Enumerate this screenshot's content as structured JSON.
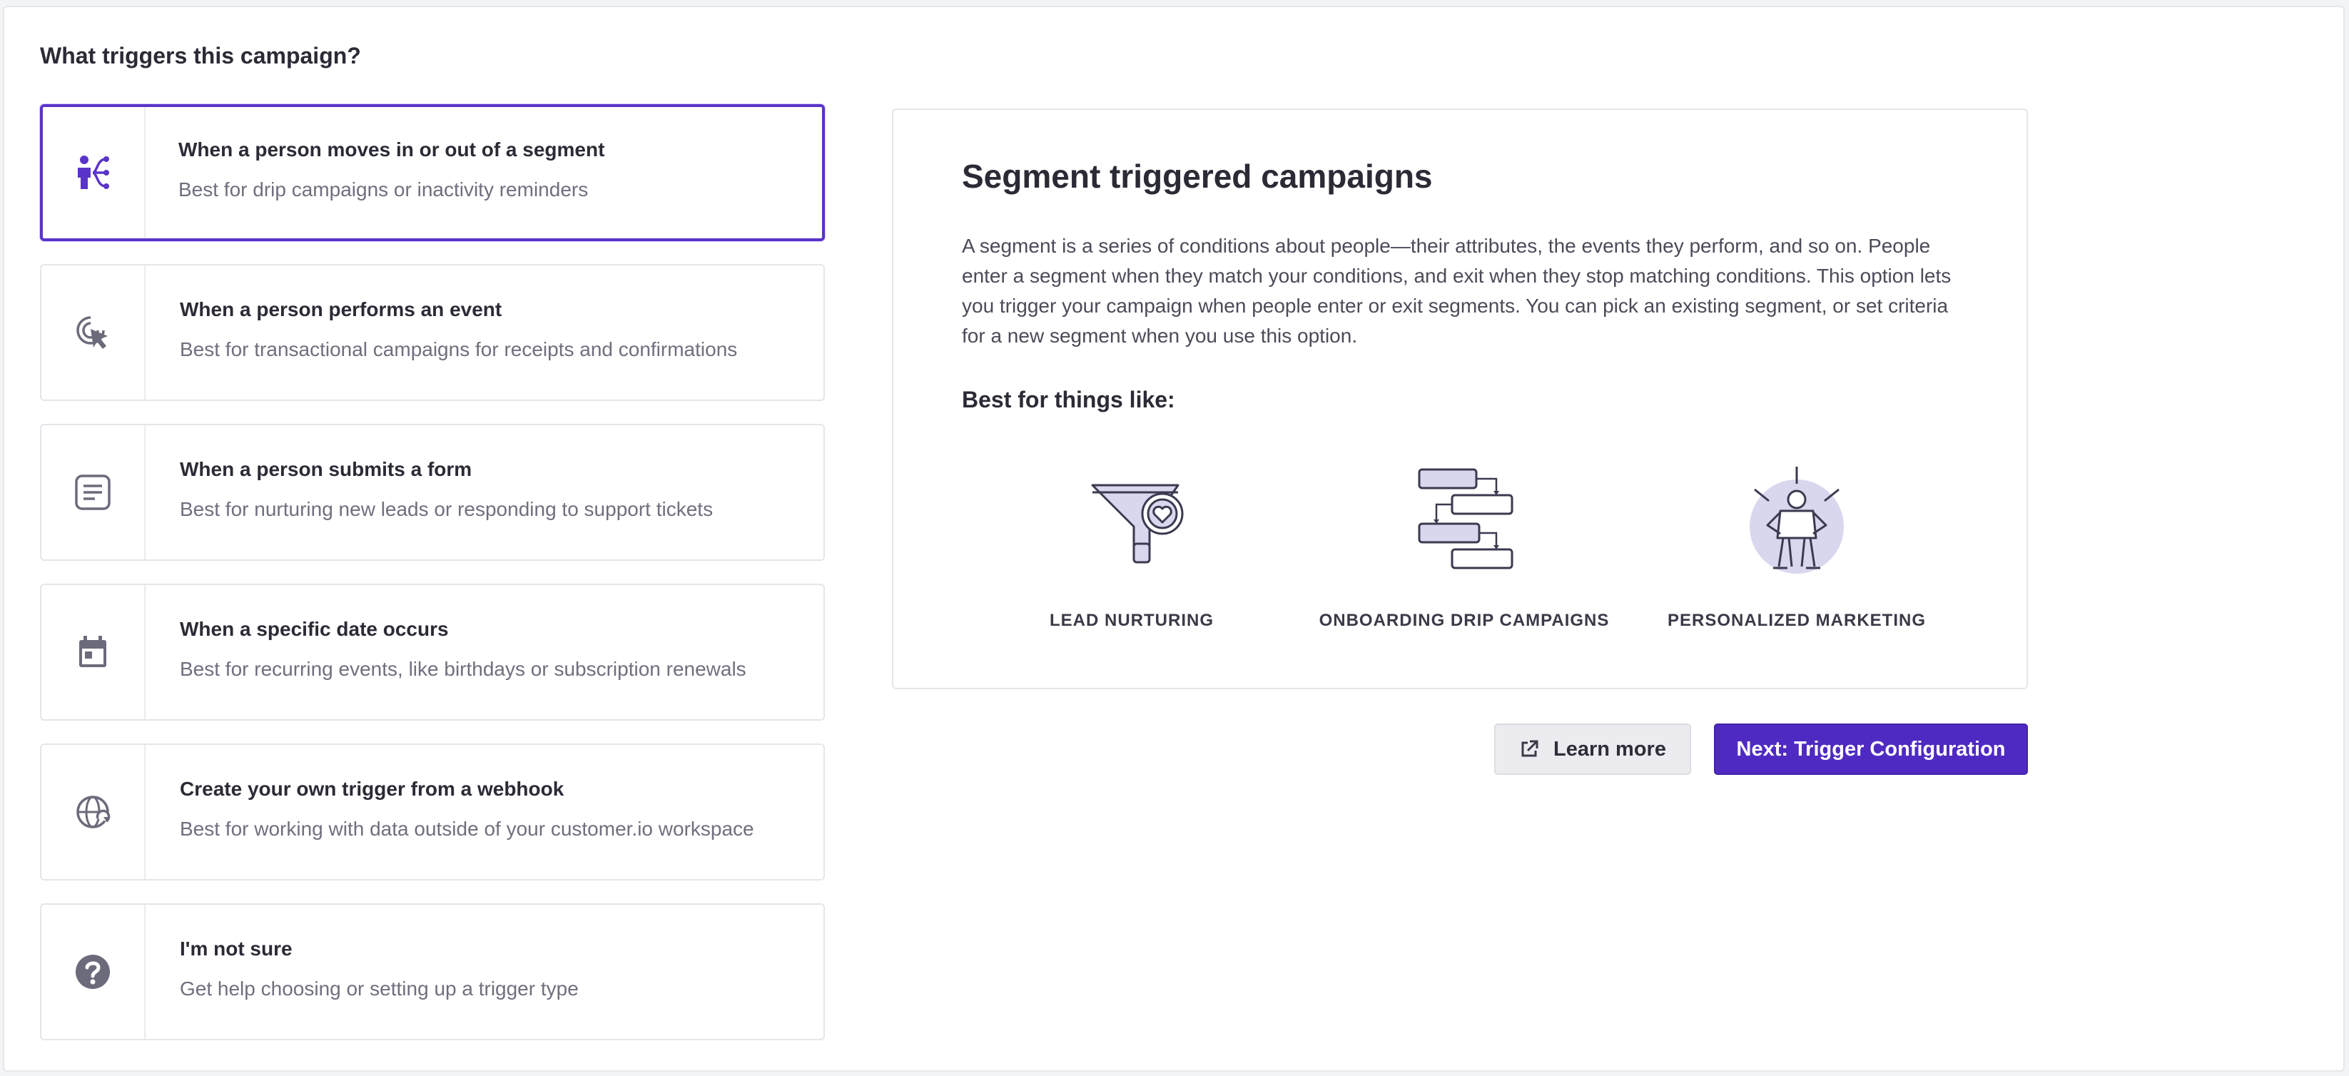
{
  "page": {
    "title": "What triggers this campaign?"
  },
  "colors": {
    "accent": "#5a34c8",
    "icon": "#6b6b7b",
    "illustration": "#d9d7ee"
  },
  "options": [
    {
      "icon": "segment-icon",
      "title": "When a person moves in or out of a segment",
      "subtitle": "Best for drip campaigns or inactivity reminders",
      "selected": true
    },
    {
      "icon": "cursor-click-icon",
      "title": "When a person performs an event",
      "subtitle": "Best for transactional campaigns for receipts and confirmations",
      "selected": false
    },
    {
      "icon": "form-icon",
      "title": "When a person submits a form",
      "subtitle": "Best for nurturing new leads or responding to support tickets",
      "selected": false
    },
    {
      "icon": "calendar-icon",
      "title": "When a specific date occurs",
      "subtitle": "Best for recurring events, like birthdays or subscription renewals",
      "selected": false
    },
    {
      "icon": "webhook-globe-icon",
      "title": "Create your own trigger from a webhook",
      "subtitle": "Best for working with data outside of your customer.io workspace",
      "selected": false
    },
    {
      "icon": "question-icon",
      "title": "I'm not sure",
      "subtitle": "Get help choosing or setting up a trigger type",
      "selected": false
    }
  ],
  "panel": {
    "title": "Segment triggered campaigns",
    "description": "A segment is a series of conditions about people—their attributes, the events they perform, and so on. People enter a segment when they match your conditions, and exit when they stop matching conditions. This option lets you trigger your campaign when people enter or exit segments. You can pick an existing segment, or set criteria for a new segment when you use this option.",
    "subheading": "Best for things like:",
    "use_cases": [
      {
        "icon": "funnel-heart-icon",
        "label": "LEAD NURTURING"
      },
      {
        "icon": "flow-steps-icon",
        "label": "ONBOARDING DRIP CAMPAIGNS"
      },
      {
        "icon": "person-spotlight-icon",
        "label": "PERSONALIZED MARKETING"
      }
    ]
  },
  "actions": {
    "learn_more": "Learn more",
    "learn_more_icon": "external-link-icon",
    "next": "Next: Trigger Configuration"
  }
}
